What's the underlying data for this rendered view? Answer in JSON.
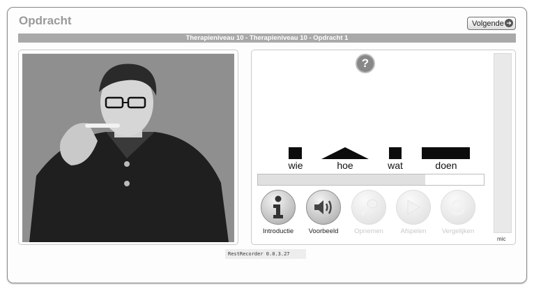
{
  "header": {
    "title": "Opdracht",
    "next_label": "Volgende",
    "level_text": "Therapieniveau 10 - Therapieniveau 10 - Opdracht 1"
  },
  "exercise": {
    "help_symbol": "?",
    "words": [
      {
        "text": "wie",
        "shape": "square"
      },
      {
        "text": "hoe",
        "shape": "triangle"
      },
      {
        "text": "wat",
        "shape": "square"
      },
      {
        "text": "doen",
        "shape": "wide-bar"
      }
    ],
    "progress": 0.74
  },
  "controls": [
    {
      "label": "Introductie",
      "icon": "info-icon",
      "enabled": true
    },
    {
      "label": "Voorbeeld",
      "icon": "speaker-icon",
      "enabled": true
    },
    {
      "label": "Opnemen",
      "icon": "microphone-icon",
      "enabled": false
    },
    {
      "label": "Afspelen",
      "icon": "play-icon",
      "enabled": false
    },
    {
      "label": "Vergelijken",
      "icon": "compare-icon",
      "enabled": false
    }
  ],
  "mic": {
    "label": "mic"
  },
  "footer": {
    "version": "RestRecorder 0.0.3.27"
  },
  "colors": {
    "level_bar": "#a9a9a9",
    "title": "#9a9a9a",
    "word_block": "#0c0c0c"
  }
}
